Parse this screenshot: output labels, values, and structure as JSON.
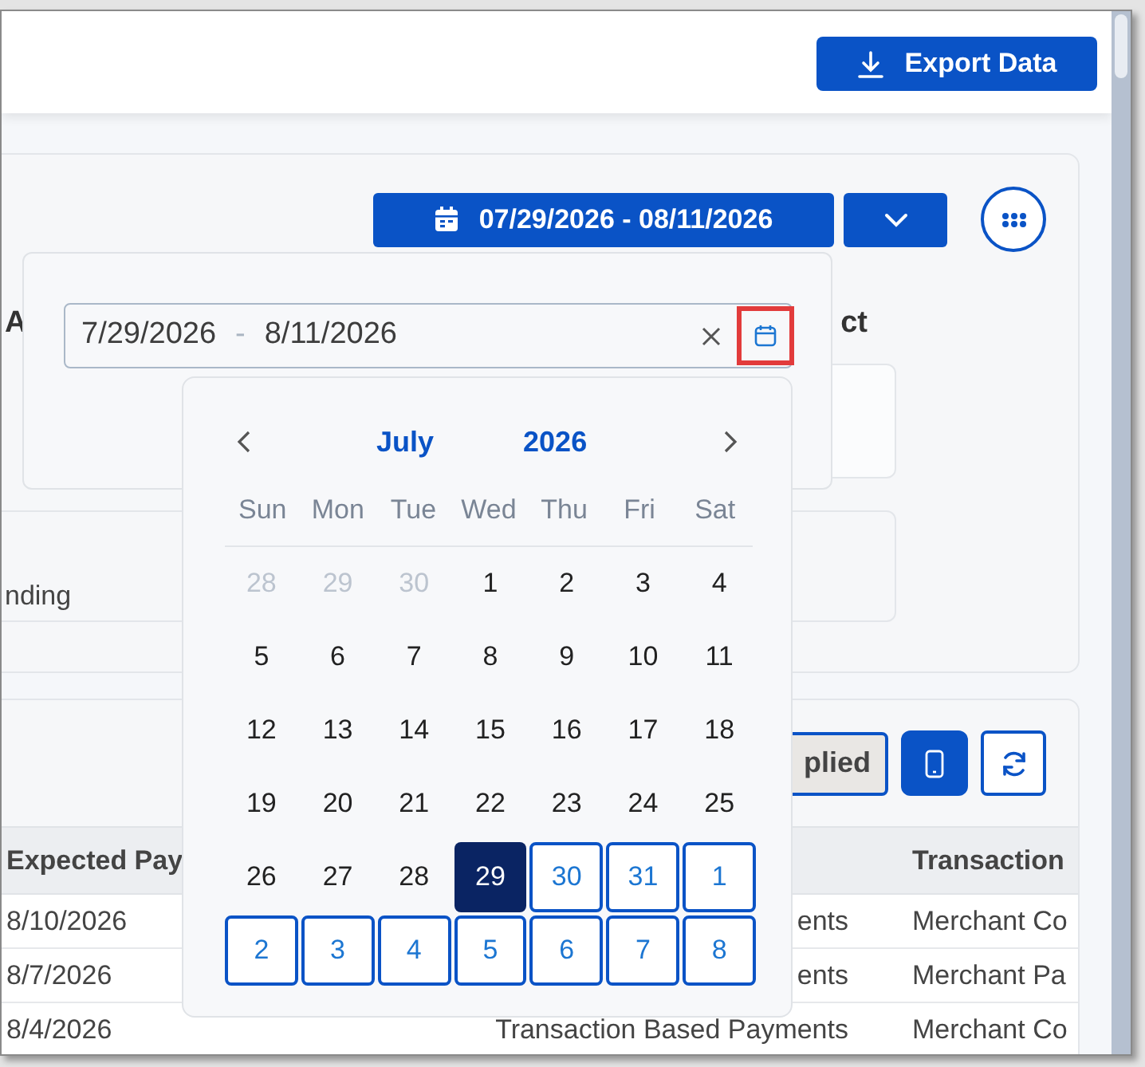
{
  "toolbar": {
    "export_button": "Export Data"
  },
  "filter_card": {
    "date_range_button": "07/29/2026 - 08/11/2026",
    "headings": [
      "A",
      "ct"
    ],
    "card_text": "nding"
  },
  "date_picker": {
    "start": "7/29/2026",
    "separator": "-",
    "end": "8/11/2026"
  },
  "calendar": {
    "month": "July",
    "year": "2026",
    "weekdays": [
      "Sun",
      "Mon",
      "Tue",
      "Wed",
      "Thu",
      "Fri",
      "Sat"
    ],
    "weeks": [
      [
        {
          "day": "28",
          "kind": "outside"
        },
        {
          "day": "29",
          "kind": "outside"
        },
        {
          "day": "30",
          "kind": "outside"
        },
        {
          "day": "1",
          "kind": "normal"
        },
        {
          "day": "2",
          "kind": "normal"
        },
        {
          "day": "3",
          "kind": "normal"
        },
        {
          "day": "4",
          "kind": "normal"
        }
      ],
      [
        {
          "day": "5",
          "kind": "normal"
        },
        {
          "day": "6",
          "kind": "normal"
        },
        {
          "day": "7",
          "kind": "normal"
        },
        {
          "day": "8",
          "kind": "normal"
        },
        {
          "day": "9",
          "kind": "normal"
        },
        {
          "day": "10",
          "kind": "normal"
        },
        {
          "day": "11",
          "kind": "normal"
        }
      ],
      [
        {
          "day": "12",
          "kind": "normal"
        },
        {
          "day": "13",
          "kind": "normal"
        },
        {
          "day": "14",
          "kind": "normal"
        },
        {
          "day": "15",
          "kind": "normal"
        },
        {
          "day": "16",
          "kind": "normal"
        },
        {
          "day": "17",
          "kind": "normal"
        },
        {
          "day": "18",
          "kind": "normal"
        }
      ],
      [
        {
          "day": "19",
          "kind": "normal"
        },
        {
          "day": "20",
          "kind": "normal"
        },
        {
          "day": "21",
          "kind": "normal"
        },
        {
          "day": "22",
          "kind": "normal"
        },
        {
          "day": "23",
          "kind": "normal"
        },
        {
          "day": "24",
          "kind": "normal"
        },
        {
          "day": "25",
          "kind": "normal"
        }
      ],
      [
        {
          "day": "26",
          "kind": "normal"
        },
        {
          "day": "27",
          "kind": "normal"
        },
        {
          "day": "28",
          "kind": "normal"
        },
        {
          "day": "29",
          "kind": "start"
        },
        {
          "day": "30",
          "kind": "range"
        },
        {
          "day": "31",
          "kind": "range"
        },
        {
          "day": "1",
          "kind": "range"
        }
      ],
      [
        {
          "day": "2",
          "kind": "range"
        },
        {
          "day": "3",
          "kind": "range"
        },
        {
          "day": "4",
          "kind": "range"
        },
        {
          "day": "5",
          "kind": "range"
        },
        {
          "day": "6",
          "kind": "range"
        },
        {
          "day": "7",
          "kind": "range"
        },
        {
          "day": "8",
          "kind": "range"
        }
      ]
    ]
  },
  "results": {
    "applied_button": "plied",
    "columns": [
      "Expected Pay",
      "",
      "Transaction"
    ],
    "rows": [
      {
        "cells": [
          "8/10/2026",
          "ents",
          "Merchant Co"
        ]
      },
      {
        "cells": [
          "8/7/2026",
          "ents",
          "Merchant Pa"
        ]
      },
      {
        "cells": [
          "8/4/2026",
          "Transaction Based Payments",
          "Merchant Co"
        ]
      }
    ]
  }
}
